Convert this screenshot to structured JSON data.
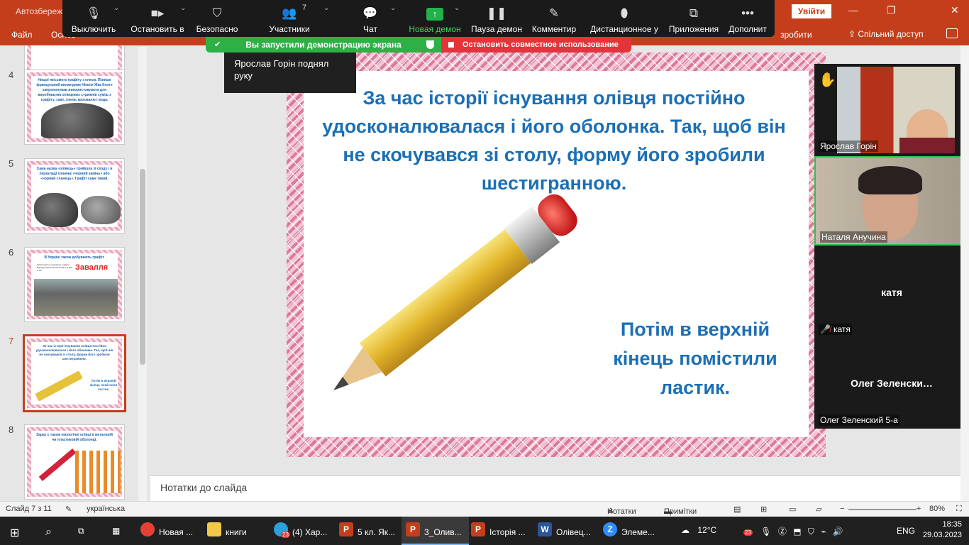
{
  "ppt": {
    "title_autosave": "Автозбереж",
    "login_button": "Увійти",
    "ribbon_file": "Файл",
    "ribbon_home": "Основ",
    "ribbon_tell": "зробити",
    "share_label": "Спільний доступ"
  },
  "zoom_toolbar": {
    "mute": "Выключить",
    "stop_video": "Остановить в",
    "security": "Безопасно",
    "participants": "Участники",
    "participants_count": "7",
    "chat": "Чат",
    "new_share": "Новая демон",
    "pause_share": "Пауза демон",
    "annotate": "Комментир",
    "remote": "Дистанционное у",
    "apps": "Приложения",
    "more": "Дополнит"
  },
  "share_banner": {
    "status": "Вы запустили демонстрацию экрана",
    "stop": "Остановить совместное использование"
  },
  "hand_popup": "Ярослав Горін поднял руку",
  "thumbnails": [
    {
      "num": "4",
      "text": "Нищої якісьмого графіту з клеєм. Пізніше французький винахідник Ніколя Жак Конте запропонував використовувати для виробництва олівцевих стрижнів суміш з графіту, сажі, глини, крохмалю і вода."
    },
    {
      "num": "5",
      "text": "Сама назва «олівець» прийшла зі сходу і в перекладі означає «чорний камінь» або «чорний сланець». Графіт саме такий."
    },
    {
      "num": "6",
      "text": "В Україні також добувають графіт.",
      "badge": "Завалля",
      "caption": "Завальевское родовище графіту. Відходи виробництва бітовіли 1.000 м 3/с"
    },
    {
      "num": "7",
      "text": "За час історії існування олівця постійно удосконалювалася і його оболонка. Так, щоб він не скочувався зі столу, форму його зробили шестигранною.",
      "sub": "Потім в верхній кінець помістили ластик."
    },
    {
      "num": "8",
      "text": "Зараз є також екологічні олівці в металевій чи пластиковій оболонці."
    }
  ],
  "slide": {
    "title": "За час історії існування олівця постійно удосконалювалася і його оболонка. Так, щоб він не скочувався зі столу, форму його зробили шестигранною.",
    "subtitle": "Потім в верхній кінець помістили ластик."
  },
  "notes_placeholder": "Нотатки до слайда",
  "participants": [
    {
      "name": "Ярослав Горін",
      "hand_raised": true
    },
    {
      "name": "Наталя Анучина",
      "active_speaker": true
    },
    {
      "name": "катя",
      "muted": true
    },
    {
      "big": "Олег  Зеленски…",
      "name": "Олег Зеленский 5-а"
    }
  ],
  "status_bar": {
    "slide_counter": "Слайд 7 з 11",
    "language": "українська",
    "notes": "Нотатки",
    "comments": "Примітки",
    "zoom": "80%"
  },
  "taskbar": {
    "items": [
      {
        "label": "Новая ...",
        "icon": "chrome-icon"
      },
      {
        "label": "книги",
        "icon": "folder-icon"
      },
      {
        "label": "(4) Хар...",
        "icon": "telegram-icon",
        "badge": "23"
      },
      {
        "label": "5 кл. Як...",
        "icon": "powerpoint-icon"
      },
      {
        "label": "3_Олив...",
        "icon": "powerpoint-icon",
        "active": true
      },
      {
        "label": "Історія ...",
        "icon": "powerpoint-icon"
      },
      {
        "label": "Олівец...",
        "icon": "word-icon"
      },
      {
        "label": "Элеме...",
        "icon": "zoom-icon"
      }
    ],
    "temperature": "12°C",
    "tray_badge": "23",
    "lang": "ENG",
    "time": "18:35",
    "date": "29.03.2023"
  }
}
